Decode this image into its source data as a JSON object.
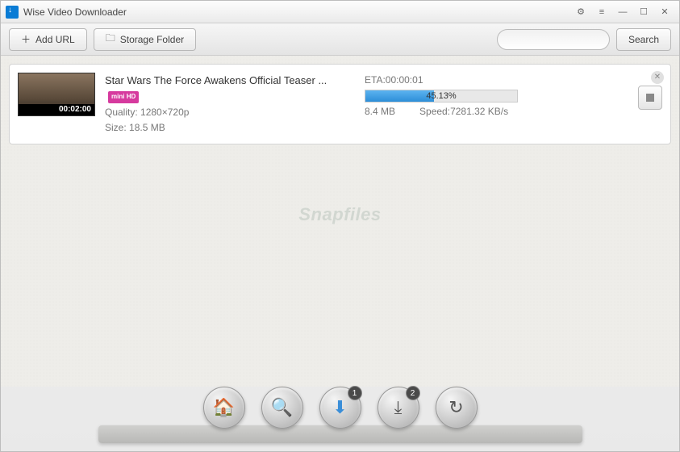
{
  "window": {
    "title": "Wise Video Downloader"
  },
  "toolbar": {
    "add_url": "Add URL",
    "storage_folder": "Storage Folder",
    "search_btn": "Search",
    "search_placeholder": ""
  },
  "download": {
    "title": "Star Wars The Force Awakens Official Teaser ...",
    "hd_badge": "HD",
    "hd_prefix": "mini",
    "duration": "00:02:00",
    "quality_label": "Quality:",
    "quality": "1280×720p",
    "size_label": "Size:",
    "size": "18.5 MB",
    "eta_label": "ETA:",
    "eta": "00:00:01",
    "progress_pct": "45.13%",
    "progress_value": 45.13,
    "downloaded": "8.4 MB",
    "speed_label": "Speed:",
    "speed": "7281.32 KB/s"
  },
  "watermark": "Snapfiles",
  "dock": {
    "badge_downloading": "1",
    "badge_done": "2"
  }
}
